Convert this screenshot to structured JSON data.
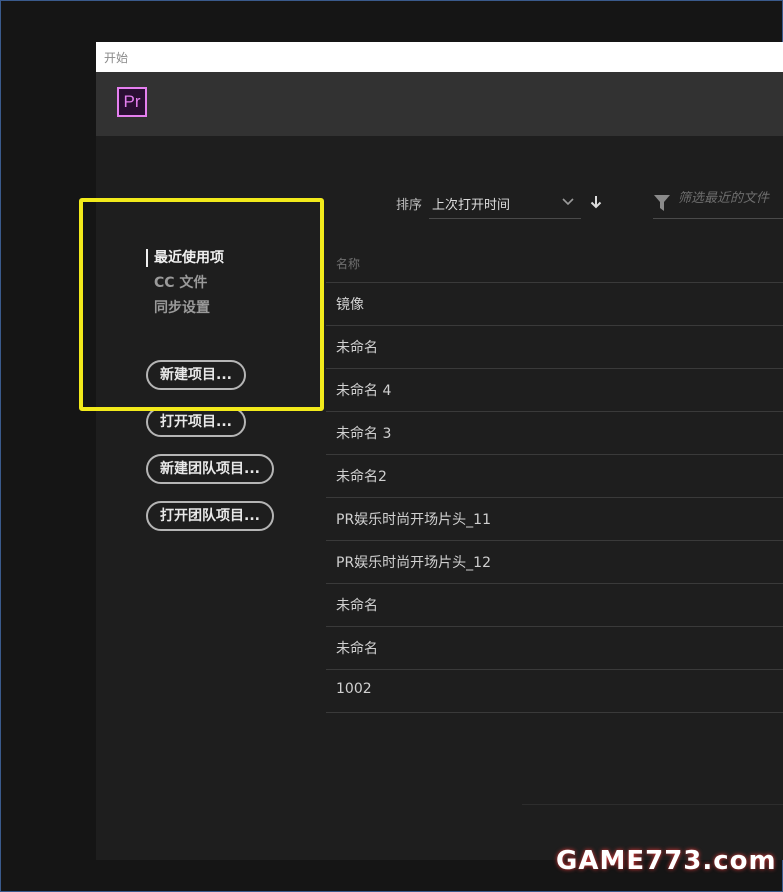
{
  "window": {
    "title": "开始",
    "logo_text": "Pr",
    "logo_color": "#e57ff0"
  },
  "sidebar": {
    "nav": [
      {
        "label": "最近使用项",
        "active": true
      },
      {
        "label": "CC 文件",
        "active": false
      },
      {
        "label": "同步设置",
        "active": false
      }
    ],
    "buttons": {
      "new_project": "新建项目...",
      "open_project": "打开项目...",
      "new_team_project": "新建团队项目...",
      "open_team_project": "打开团队项目..."
    },
    "highlight_color": "#f2ea1b"
  },
  "sort": {
    "label": "排序",
    "value": "上次打开时间",
    "direction_icon": "arrow-down-icon"
  },
  "filter": {
    "placeholder": "筛选最近的文件",
    "value": ""
  },
  "recent": {
    "column_header": "名称",
    "items": [
      "镜像",
      "未命名",
      "未命名 4",
      "未命名 3",
      "未命名2",
      "PR娱乐时尚开场片头_11",
      "PR娱乐时尚开场片头_12",
      "未命名",
      "未命名",
      "1002"
    ]
  },
  "watermark": {
    "text": "GAME773.com"
  }
}
